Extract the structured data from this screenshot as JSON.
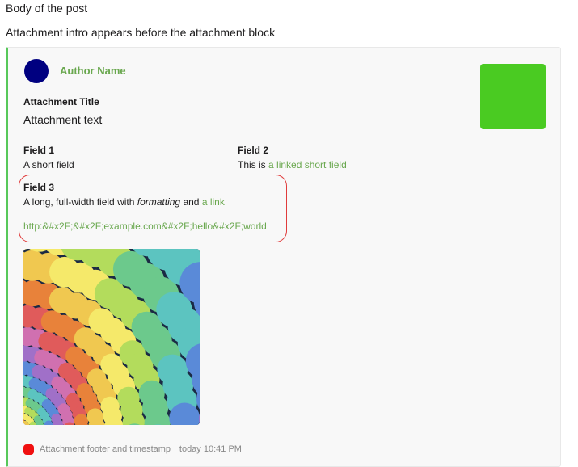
{
  "post": {
    "body": "Body of the post",
    "attachment_intro": "Attachment intro appears before the attachment block"
  },
  "attachment": {
    "author_name": "Author Name",
    "title": "Attachment Title",
    "text": "Attachment text",
    "colors": {
      "border": "#57c85a",
      "avatar": "#000080",
      "thumb": "#4acb22",
      "link": "#6aa84f",
      "highlight": "#e03b3b",
      "footer_icon": "#f01010"
    },
    "fields": [
      {
        "title": "Field 1",
        "value": "A short field"
      },
      {
        "title": "Field 2",
        "value_prefix": "This is ",
        "value_link": "a linked short field"
      },
      {
        "title": "Field 3",
        "value_prefix": "A long, full-width field with ",
        "value_italic": "formatting",
        "value_mid": " and ",
        "value_link": "a link",
        "value_url": "http:&#x2F;&#x2F;example.com&#x2F;hello&#x2F;world"
      }
    ],
    "footer": {
      "text": "Attachment footer and timestamp",
      "separator": "|",
      "timestamp": "today 10:41 PM"
    }
  }
}
